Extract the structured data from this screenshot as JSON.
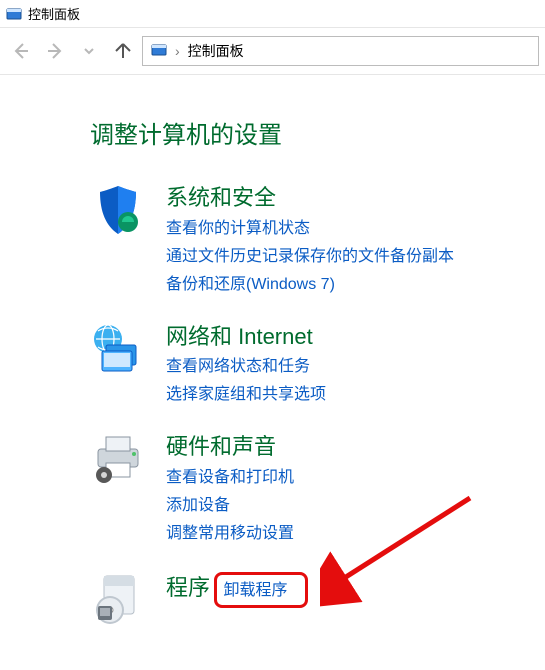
{
  "window": {
    "title": "控制面板"
  },
  "address": {
    "location": "控制面板",
    "separator": "›"
  },
  "heading": "调整计算机的设置",
  "categories": [
    {
      "key": "system-security",
      "title": "系统和安全",
      "links": [
        "查看你的计算机状态",
        "通过文件历史记录保存你的文件备份副本",
        "备份和还原(Windows 7)"
      ]
    },
    {
      "key": "network",
      "title": "网络和 Internet",
      "links": [
        "查看网络状态和任务",
        "选择家庭组和共享选项"
      ]
    },
    {
      "key": "hardware-sound",
      "title": "硬件和声音",
      "links": [
        "查看设备和打印机",
        "添加设备",
        "调整常用移动设置"
      ]
    },
    {
      "key": "programs",
      "title": "程序",
      "links": [
        "卸载程序"
      ]
    }
  ]
}
